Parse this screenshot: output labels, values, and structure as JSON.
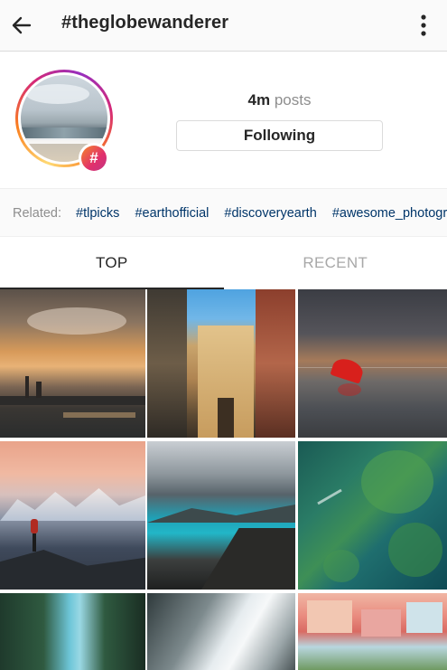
{
  "topbar": {
    "title": "#theglobewanderer",
    "back_icon": "arrow-left-icon",
    "more_icon": "more-vertical-icon"
  },
  "profile": {
    "posts_count": "4m",
    "posts_label": "posts",
    "following_label": "Following",
    "badge_glyph": "#"
  },
  "related": {
    "label": "Related:",
    "tags": [
      "#tlpicks",
      "#earthofficial",
      "#discoveryearth",
      "#awesome_photographers"
    ]
  },
  "tabs": {
    "top": "TOP",
    "recent": "RECENT",
    "active": "TOP"
  },
  "grid": {
    "items": [
      "city-skyline-storm-photo",
      "colorful-street-buildings-photo",
      "red-umbrella-seascape-photo",
      "mountain-hiker-photo",
      "glacial-lake-coast-photo",
      "aerial-jungle-river-photo",
      "ice-cave-river-photo",
      "light-rays-forest-photo",
      "pastel-houses-photo"
    ]
  },
  "colors": {
    "text": "#262626",
    "muted": "#8e8e8e",
    "link": "#003569",
    "border": "#dbdbdb",
    "badge_gradient_start": "#f58529",
    "badge_gradient_end": "#c13584"
  }
}
